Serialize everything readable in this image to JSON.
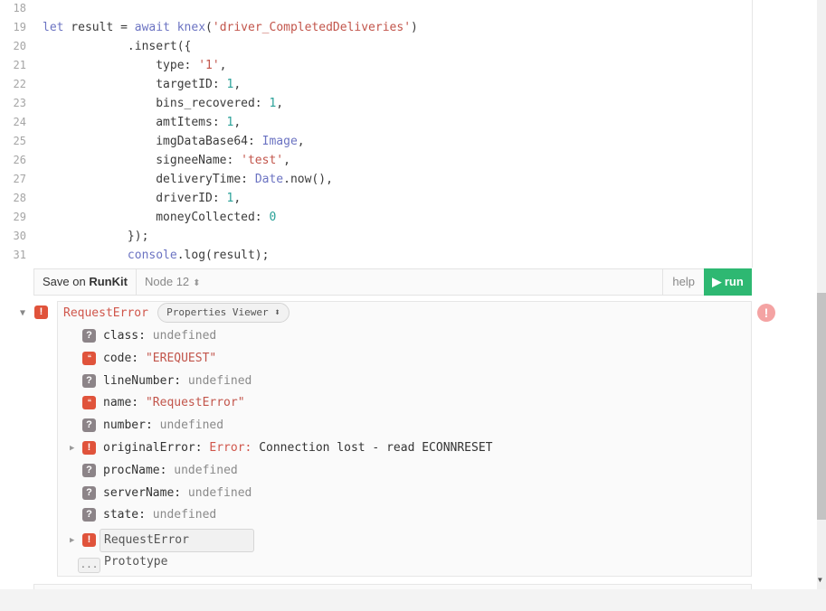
{
  "editor": {
    "lines": [
      {
        "n": "18",
        "parts": []
      },
      {
        "n": "19",
        "parts": [
          {
            "t": "let",
            "c": "kw"
          },
          {
            "t": " result = ",
            "c": ""
          },
          {
            "t": "await",
            "c": "kw"
          },
          {
            "t": " ",
            "c": ""
          },
          {
            "t": "knex",
            "c": "gl"
          },
          {
            "t": "(",
            "c": ""
          },
          {
            "t": "'driver_CompletedDeliveries'",
            "c": "str"
          },
          {
            "t": ")",
            "c": ""
          }
        ]
      },
      {
        "n": "20",
        "parts": [
          {
            "t": "            .insert({",
            "c": ""
          }
        ]
      },
      {
        "n": "21",
        "parts": [
          {
            "t": "                type: ",
            "c": ""
          },
          {
            "t": "'1'",
            "c": "str"
          },
          {
            "t": ",",
            "c": ""
          }
        ]
      },
      {
        "n": "22",
        "parts": [
          {
            "t": "                targetID: ",
            "c": ""
          },
          {
            "t": "1",
            "c": "num"
          },
          {
            "t": ",",
            "c": ""
          }
        ]
      },
      {
        "n": "23",
        "parts": [
          {
            "t": "                bins_recovered: ",
            "c": ""
          },
          {
            "t": "1",
            "c": "num"
          },
          {
            "t": ",",
            "c": ""
          }
        ]
      },
      {
        "n": "24",
        "parts": [
          {
            "t": "                amtItems: ",
            "c": ""
          },
          {
            "t": "1",
            "c": "num"
          },
          {
            "t": ",",
            "c": ""
          }
        ]
      },
      {
        "n": "25",
        "parts": [
          {
            "t": "                imgDataBase64: ",
            "c": ""
          },
          {
            "t": "Image",
            "c": "gl"
          },
          {
            "t": ",",
            "c": ""
          }
        ]
      },
      {
        "n": "26",
        "parts": [
          {
            "t": "                signeeName: ",
            "c": ""
          },
          {
            "t": "'test'",
            "c": "str"
          },
          {
            "t": ",",
            "c": ""
          }
        ]
      },
      {
        "n": "27",
        "parts": [
          {
            "t": "                deliveryTime: ",
            "c": ""
          },
          {
            "t": "Date",
            "c": "gl"
          },
          {
            "t": ".now(),",
            "c": ""
          }
        ]
      },
      {
        "n": "28",
        "parts": [
          {
            "t": "                driverID: ",
            "c": ""
          },
          {
            "t": "1",
            "c": "num"
          },
          {
            "t": ",",
            "c": ""
          }
        ]
      },
      {
        "n": "29",
        "parts": [
          {
            "t": "                moneyCollected: ",
            "c": ""
          },
          {
            "t": "0",
            "c": "num"
          }
        ]
      },
      {
        "n": "30",
        "parts": [
          {
            "t": "            });",
            "c": ""
          }
        ]
      },
      {
        "n": "31",
        "parts": [
          {
            "t": "            ",
            "c": ""
          },
          {
            "t": "console",
            "c": "gl"
          },
          {
            "t": ".log(result);",
            "c": ""
          }
        ]
      }
    ]
  },
  "toolbar": {
    "save_prefix": "Save on ",
    "save_brand": "RunKit",
    "node_version": "Node 12",
    "help_label": "help",
    "run_label": "run"
  },
  "output": {
    "error_title": "RequestError",
    "viewer_label": "Properties Viewer",
    "props": [
      {
        "key": "class",
        "sep": ": ",
        "val": "undefined",
        "type": "undef",
        "badge": "q"
      },
      {
        "key": "code",
        "sep": ": ",
        "val": "\"EREQUEST\"",
        "type": "str",
        "badge": "str"
      },
      {
        "key": "lineNumber",
        "sep": ": ",
        "val": "undefined",
        "type": "undef",
        "badge": "q"
      },
      {
        "key": "name",
        "sep": ": ",
        "val": "\"RequestError\"",
        "type": "str",
        "badge": "str"
      },
      {
        "key": "number",
        "sep": ": ",
        "val": "undefined",
        "type": "undef",
        "badge": "q"
      },
      {
        "key": "originalError",
        "sep": ": ",
        "val": "Connection lost - read ECONNRESET",
        "prefix": "Error: ",
        "type": "err",
        "badge": "err",
        "expandable": true
      },
      {
        "key": "procName",
        "sep": ": ",
        "val": "undefined",
        "type": "undef",
        "badge": "q"
      },
      {
        "key": "serverName",
        "sep": ": ",
        "val": "undefined",
        "type": "undef",
        "badge": "q"
      },
      {
        "key": "state",
        "sep": ": ",
        "val": "undefined",
        "type": "undef",
        "badge": "q"
      }
    ],
    "prototype_label": "RequestError Prototype",
    "ellipsis_label": "..."
  },
  "icons": {
    "error_badge": "!",
    "unknown_badge": "?",
    "string_badge": "“",
    "expand": "▶",
    "collapse": "▼",
    "updown": "⬍"
  },
  "colors": {
    "run_button": "#2eb872",
    "error": "#e0533b"
  }
}
